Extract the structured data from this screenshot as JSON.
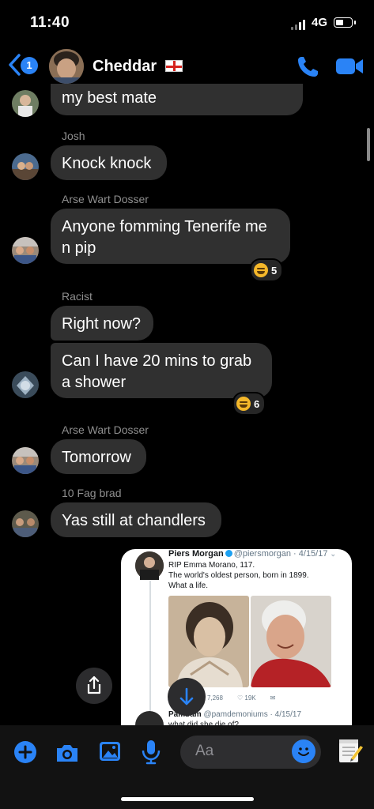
{
  "status_bar": {
    "time": "11:40",
    "network": "4G"
  },
  "header": {
    "back_badge": "1",
    "title": "Cheddar",
    "title_flag": "england-flag-icon",
    "accent": "#2a83f6"
  },
  "messages": [
    {
      "sender": "",
      "text": "my best mate"
    },
    {
      "sender": "Josh",
      "text": "Knock knock"
    },
    {
      "sender": "Arse Wart Dosser",
      "text_line1": "Anyone fomming Tenerife me",
      "text_line2": "n pip",
      "reaction_count": "5"
    },
    {
      "sender": "Racist",
      "text": "Right now?"
    },
    {
      "sender": "",
      "text_line1": "Can I have 20 mins to grab",
      "text_line2": "a shower",
      "reaction_count": "6"
    },
    {
      "sender": "Arse Wart Dosser",
      "text": "Tomorrow"
    },
    {
      "sender": "10 Fag brad",
      "text": "Yas still at chandlers"
    }
  ],
  "shared_image": {
    "name": "Piers Morgan",
    "handle": "@piersmorgan · 4/15/17",
    "text_line1": "RIP Emma Morano, 117.",
    "text_line2": "The world's oldest person, born in 1899.",
    "text_line3": "What a life.",
    "retweets": "7,268",
    "likes": "19K",
    "reply_name": "Pam",
    "reply_name_rest": "bam",
    "reply_handle": "@pamdemoniums · 4/15/17",
    "reply_text": "what did she die of?"
  },
  "composer": {
    "placeholder": "Aa"
  }
}
